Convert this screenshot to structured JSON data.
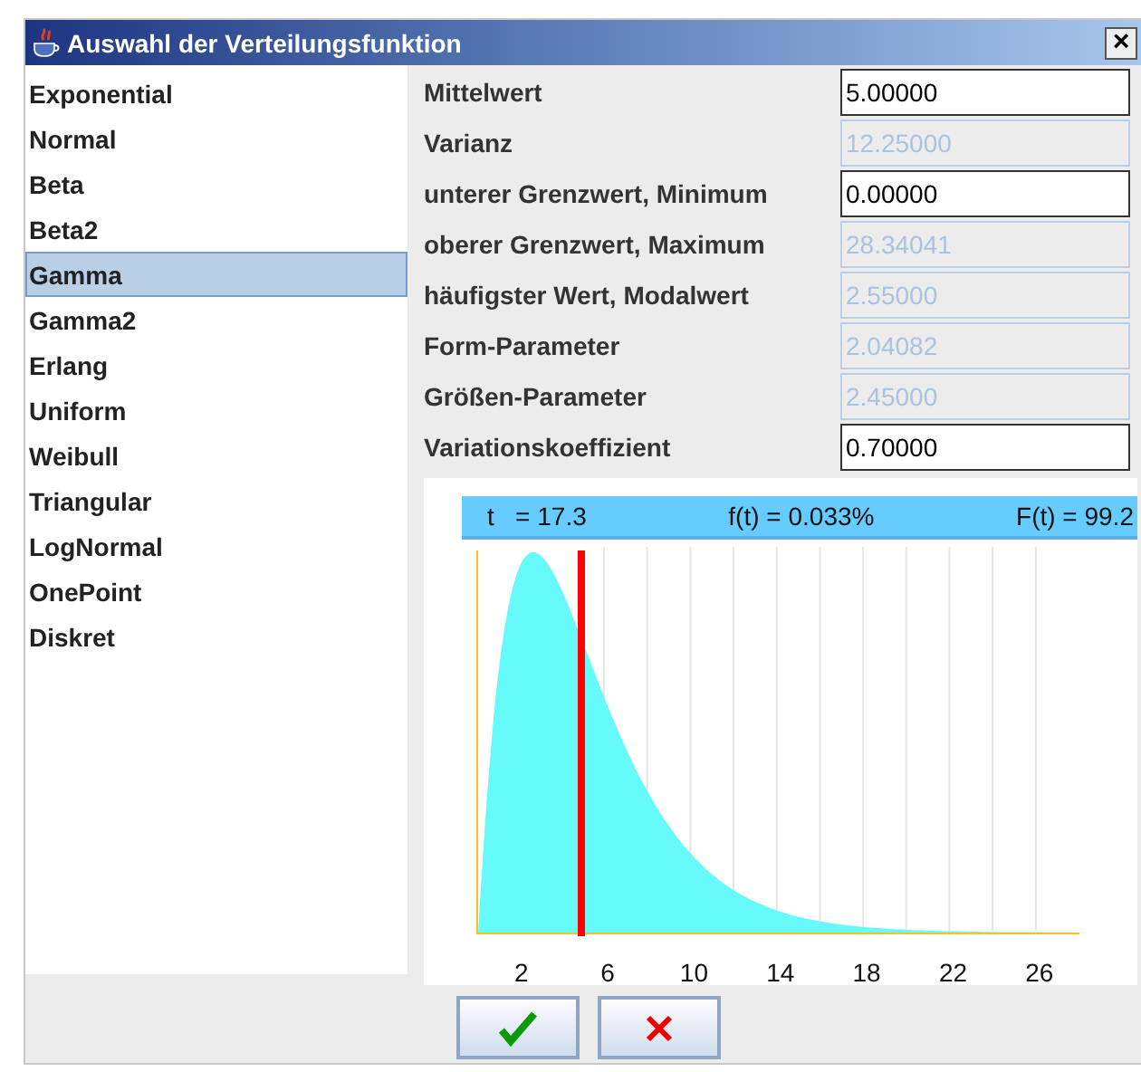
{
  "window": {
    "title": "Auswahl der Verteilungsfunktion",
    "close": "×"
  },
  "distributions": [
    {
      "label": "Exponential",
      "selected": false
    },
    {
      "label": "Normal",
      "selected": false
    },
    {
      "label": "Beta",
      "selected": false
    },
    {
      "label": "Beta2",
      "selected": false
    },
    {
      "label": "Gamma",
      "selected": true
    },
    {
      "label": "Gamma2",
      "selected": false
    },
    {
      "label": "Erlang",
      "selected": false
    },
    {
      "label": "Uniform",
      "selected": false
    },
    {
      "label": "Weibull",
      "selected": false
    },
    {
      "label": "Triangular",
      "selected": false
    },
    {
      "label": "LogNormal",
      "selected": false
    },
    {
      "label": "OnePoint",
      "selected": false
    },
    {
      "label": "Diskret",
      "selected": false
    }
  ],
  "parameters": [
    {
      "label": "Mittelwert",
      "value": "5.00000",
      "disabled": false
    },
    {
      "label": "Varianz",
      "value": "12.25000",
      "disabled": true
    },
    {
      "label": "unterer Grenzwert, Minimum",
      "value": "0.00000",
      "disabled": false
    },
    {
      "label": "oberer Grenzwert, Maximum",
      "value": "28.34041",
      "disabled": true
    },
    {
      "label": "häufigster Wert, Modalwert",
      "value": "2.55000",
      "disabled": true
    },
    {
      "label": "Form-Parameter",
      "value": "2.04082",
      "disabled": true
    },
    {
      "label": "Größen-Parameter",
      "value": "2.45000",
      "disabled": true
    },
    {
      "label": "Variationskoeffizient",
      "value": "0.70000",
      "disabled": false
    }
  ],
  "plot": {
    "readout": [
      "t   = 17.3",
      "f(t) = 0.033%",
      "F(t) = 99.2"
    ],
    "axis_labels": [
      "2",
      "6",
      "10",
      "14",
      "18",
      "22",
      "26"
    ]
  },
  "buttons": [
    {
      "kind": "ok"
    },
    {
      "kind": "cancel"
    }
  ]
}
